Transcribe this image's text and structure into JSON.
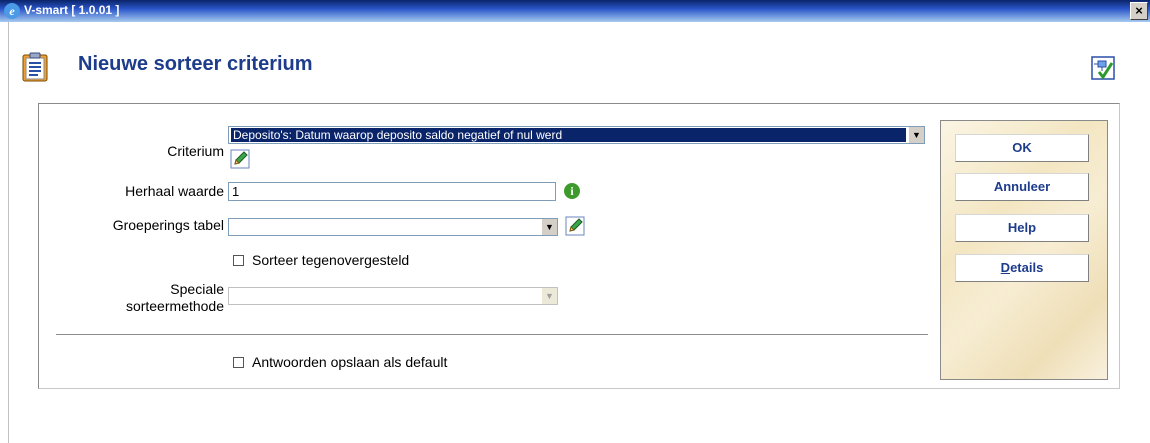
{
  "window": {
    "title": "V-smart [ 1.0.01 ]",
    "close_glyph": "×"
  },
  "header": {
    "title": "Nieuwe sorteer criterium"
  },
  "form": {
    "criterium_label": "Criterium",
    "criterium_value": "Deposito's: Datum waarop deposito saldo negatief of nul werd",
    "herhaal_label": "Herhaal waarde",
    "herhaal_value": "1",
    "groepering_label": "Groeperings tabel",
    "groepering_value": "",
    "sorteer_label": "Sorteer tegenovergesteld",
    "sorteer_checked": false,
    "speciale_label_line1": "Speciale",
    "speciale_label_line2": "sorteermethode",
    "speciale_value": "",
    "antwoorden_label": "Antwoorden opslaan als default",
    "antwoorden_checked": false
  },
  "buttons": {
    "ok": "OK",
    "annuleer": "Annuleer",
    "help": "Help",
    "details_first": "D",
    "details_rest": "etails"
  },
  "icons": {
    "app": "internet-explorer-icon",
    "header": "clipboard-list-icon",
    "help": "help-flow-icon",
    "edit": "pencil-icon",
    "info": "info-icon"
  },
  "colors": {
    "title": "#1d3c8c",
    "selection": "#0a246a",
    "titlebar": "#0a246a"
  }
}
